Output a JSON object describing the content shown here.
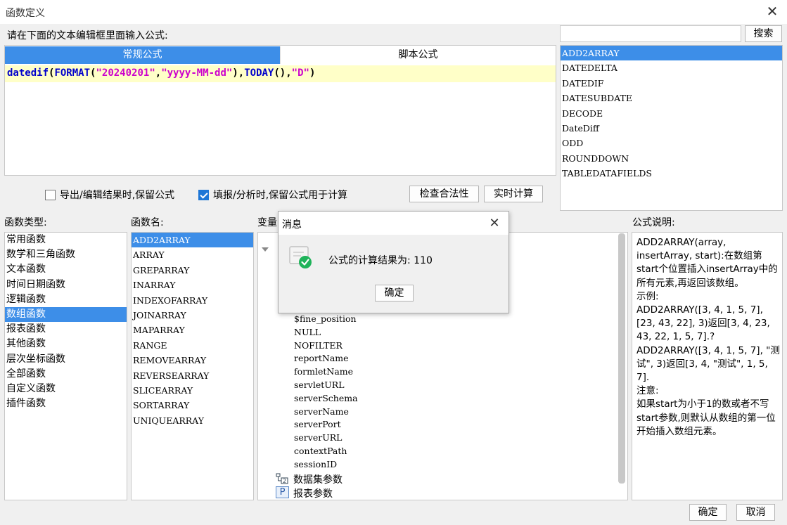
{
  "window": {
    "title": "函数定义",
    "close_glyph": "✕"
  },
  "editor": {
    "prompt": "请在下面的文本编辑框里面输入公式:",
    "tabs": [
      {
        "label": "常规公式",
        "active": true
      },
      {
        "label": "脚本公式",
        "active": false
      }
    ],
    "formula": {
      "fn_datedif": "datedif",
      "p_open1": "(",
      "fn_format": "FORMAT",
      "p_open2": "(",
      "str_date": "\"20240201\"",
      "comma1": ",",
      "str_fmt": "\"yyyy-MM-dd\"",
      "p_close_comma": "),",
      "fn_today": "TODAY",
      "p_today": "(),",
      "str_d": "\"D\"",
      "p_close": ")"
    },
    "options": [
      {
        "label": "导出/编辑结果时,保留公式",
        "checked": false
      },
      {
        "label": "填报/分析时,保留公式用于计算",
        "checked": true
      }
    ],
    "check_button": "检查合法性",
    "realtime_button": "实时计算"
  },
  "search": {
    "placeholder": "",
    "button": "搜索"
  },
  "search_results": [
    "ADD2ARRAY",
    "DATEDELTA",
    "DATEDIF",
    "DATESUBDATE",
    "DECODE",
    "DateDiff",
    "ODD",
    "ROUNDDOWN",
    "TABLEDATAFIELDS"
  ],
  "categories": {
    "label": "函数类型:",
    "items": [
      "常用函数",
      "数学和三角函数",
      "文本函数",
      "时间日期函数",
      "逻辑函数",
      "数组函数",
      "报表函数",
      "其他函数",
      "层次坐标函数",
      "全部函数",
      "自定义函数",
      "插件函数"
    ],
    "selected_index": 5
  },
  "functions": {
    "label": "函数名:",
    "items": [
      "ADD2ARRAY",
      "ARRAY",
      "GREPARRAY",
      "INARRAY",
      "INDEXOFARRAY",
      "JOINARRAY",
      "MAPARRAY",
      "RANGE",
      "REMOVEARRAY",
      "REVERSEARRAY",
      "SLICEARRAY",
      "SORTARRAY",
      "UNIQUEARRAY"
    ],
    "selected_index": 0
  },
  "variables": {
    "label": "变量",
    "items": [
      "$fine_position",
      "NULL",
      "NOFILTER",
      "reportName",
      "formletName",
      "servletURL",
      "serverSchema",
      "serverName",
      "serverPort",
      "serverURL",
      "contextPath",
      "sessionID"
    ],
    "dataset_params": "数据集参数",
    "report_params": "报表参数",
    "report_params_icon_text": "P"
  },
  "description": {
    "label": "公式说明:",
    "lines": [
      "ADD2ARRAY(array, insertArray, start):在数组第start个位置插入insertArray中的所有元素,再返回该数组。",
      "示例:",
      "ADD2ARRAY([3, 4, 1, 5, 7], [23, 43, 22], 3)返回[3, 4, 23, 43, 22, 1, 5, 7].?",
      "ADD2ARRAY([3, 4, 1, 5, 7], \"测试\", 3)返回[3, 4, \"测试\", 1, 5, 7].",
      "注意:",
      "如果start为小于1的数或者不写start参数,则默认从数组的第一位开始插入数组元素。"
    ]
  },
  "footer": {
    "ok": "确定",
    "cancel": "取消"
  },
  "dialog": {
    "title": "消息",
    "close_glyph": "✕",
    "message": "公式的计算结果为: 110",
    "ok": "确定"
  },
  "colors": {
    "accent": "#3d8ee8",
    "success": "#1fb35a",
    "formula_fn": "#0000cc",
    "formula_str": "#cc00cc",
    "formula_bg": "#ffffc8"
  }
}
